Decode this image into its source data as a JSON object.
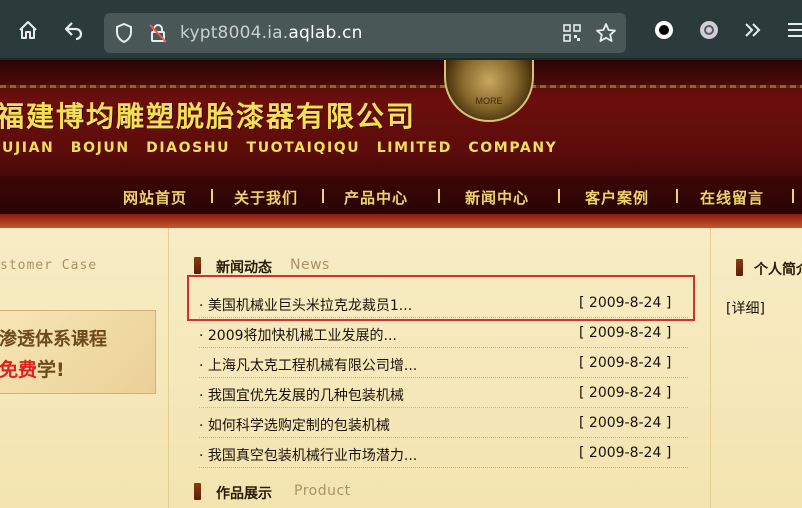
{
  "browser": {
    "url_prefix": "kypt8004.ia.",
    "url_domain": "aqlab.cn",
    "icons": [
      "home-icon",
      "back-icon",
      "shield-icon",
      "insecure-lock-icon",
      "qr-code-icon",
      "bookmark-star-icon",
      "extension-circle-icon",
      "extension-badge-icon",
      "overflow-chevrons-icon",
      "menu-icon"
    ]
  },
  "header": {
    "company_cn": "福建博均雕塑脱胎漆器有限公司",
    "company_en": "UJIAN BOJUN DIAOSHU TUOTAIQIQU LIMITED COMPANY",
    "emblem_text": "MORE",
    "nav": [
      "网站首页",
      "关于我们",
      "产品中心",
      "新闻中心",
      "客户案例",
      "在线留言"
    ]
  },
  "left": {
    "heading": "stomer Case",
    "ad_line1": "渗透体系课程",
    "ad_line2_red": "免费",
    "ad_line2_rest": "学!"
  },
  "news": {
    "title_cn": "新闻动态",
    "title_en": "News",
    "items": [
      {
        "title": "· 美国机械业巨头米拉克龙裁员1...",
        "date": "[ 2009-8-24 ]"
      },
      {
        "title": "· 2009将加快机械工业发展的...",
        "date": "[ 2009-8-24 ]"
      },
      {
        "title": "· 上海凡太克工程机械有限公司增...",
        "date": "[ 2009-8-24 ]"
      },
      {
        "title": "· 我国宜优先发展的几种包装机械",
        "date": "[ 2009-8-24 ]"
      },
      {
        "title": "· 如何科学选购定制的包装机械",
        "date": "[ 2009-8-24 ]"
      },
      {
        "title": "· 我国真空包装机械行业市场潜力...",
        "date": "[ 2009-8-24 ]"
      }
    ]
  },
  "products": {
    "title_cn": "作品展示",
    "title_en": "Product"
  },
  "profile": {
    "title_cn": "个人简介",
    "detail_link": "[详细]"
  }
}
